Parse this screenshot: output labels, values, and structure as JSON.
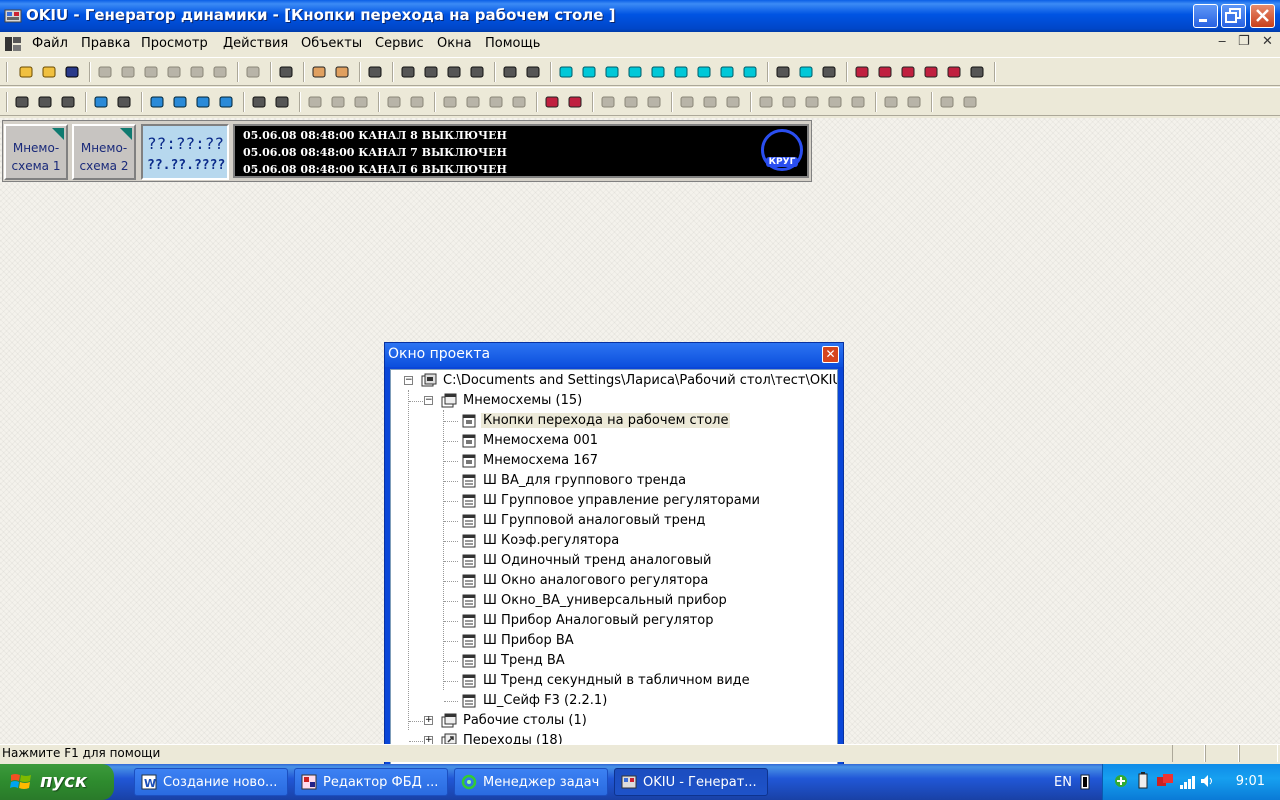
{
  "window": {
    "title": "OKIU - Генератор динамики - [Кнопки перехода на рабочем столе ]"
  },
  "menu": {
    "items": [
      "Файл",
      "Правка",
      "Просмотр",
      "Действия",
      "Объекты",
      "Сервис",
      "Окна",
      "Помощь"
    ],
    "mdi_controls": [
      "‒",
      "❐",
      "✕"
    ]
  },
  "toolbar1_icons": [
    "new-icon",
    "open-icon",
    "save-icon",
    "cut-icon",
    "cut2-icon",
    "copy-icon",
    "paste-icon",
    "paste2-icon",
    "duplicate-icon",
    "undo-icon",
    "print-icon",
    "user-icon",
    "user2-icon",
    "find-icon",
    "window1-icon",
    "window2-icon",
    "window3-icon",
    "window4-icon",
    "text-icon",
    "image-icon",
    "rect-icon",
    "rect2-icon",
    "roundrect-icon",
    "ellipse-icon",
    "polygon-icon",
    "shape1-icon",
    "shape2-icon",
    "arc-icon",
    "curve-icon",
    "line-icon",
    "arc2-icon",
    "polyline-icon",
    "trend-icon",
    "chart-icon",
    "table-icon",
    "grid-icon",
    "list-icon",
    "format-icon"
  ],
  "toolbar2_icons": [
    "pointer-icon",
    "node-edit-icon",
    "rotate-icon",
    "zoom-icon",
    "hand-icon",
    "zoom-1to1-icon",
    "zoom-fit-icon",
    "zoom-out-icon",
    "zoom-in-icon",
    "export-icon",
    "import-icon",
    "group-icon",
    "ungroup-icon",
    "align1-icon",
    "align2-icon",
    "align3-icon",
    "front-icon",
    "back-icon",
    "forward-icon",
    "backward-icon",
    "grid-on-icon",
    "grid-snap-icon",
    "align-left-icon",
    "align-center-icon",
    "align-right-icon",
    "align-top-icon",
    "align-middle-icon",
    "align-bottom-icon",
    "space-h-icon",
    "space-v-icon",
    "center-icon",
    "dist-h-icon",
    "dist-v-icon",
    "flip-h-icon",
    "flip-v-icon",
    "rotate-l-icon",
    "rotate-r-icon"
  ],
  "panel": {
    "buttons": [
      {
        "line1": "Мнемо-",
        "line2": "схема 1"
      },
      {
        "line1": "Мнемо-",
        "line2": "схема 2"
      }
    ],
    "clock_time": "??:??:??",
    "clock_date": "??.??.????",
    "alarms": [
      "05.06.08 08:48:00  КАНАЛ 8 ВЫКЛЮЧЕН",
      "05.06.08 08:48:00  КАНАЛ 7 ВЫКЛЮЧЕН",
      "05.06.08 08:48:00  КАНАЛ 6 ВЫКЛЮЧЕН"
    ],
    "logo_text": "КРУГ"
  },
  "project_window": {
    "title": "Окно проекта",
    "root": "C:\\Documents and Settings\\Лариса\\Рабочий стол\\тест\\OKIU.F",
    "group_mnemo": "Мнемосхемы (15)",
    "items": [
      "Кнопки перехода на рабочем столе",
      "Мнемосхема 001",
      "Мнемосхема 167",
      "Ш ВА_для группового тренда",
      "Ш Групповое управление регуляторами",
      "Ш Групповой аналоговый тренд",
      "Ш Коэф.регулятора",
      "Ш Одиночный тренд аналоговый",
      "Ш Окно аналогового регулятора",
      "Ш Окно_ВА_универсальный прибор",
      "Ш Прибор Аналоговый регулятор",
      "Ш Прибор ВА",
      "Ш Тренд ВА",
      "Ш Тренд секундный в табличном виде",
      "Ш_Сейф F3 (2.2.1)"
    ],
    "group_desktops": "Рабочие столы (1)",
    "group_transitions": "Переходы (18)"
  },
  "status": {
    "text": "Нажмите  F1 для помощи"
  },
  "taskbar": {
    "start": "пуск",
    "tasks": [
      {
        "label": "Создание ново..."
      },
      {
        "label": "Редактор ФБД ..."
      },
      {
        "label": "Менеджер задач"
      },
      {
        "label": "OKIU - Генерат..."
      }
    ],
    "language": "EN",
    "clock": "9:01"
  },
  "colors": {
    "title_blue": "#0054e3",
    "taskbar_blue": "#245edb",
    "start_green": "#3c9a3c",
    "alarm_bg": "#000000",
    "clock_bg": "#b7d8ee"
  }
}
